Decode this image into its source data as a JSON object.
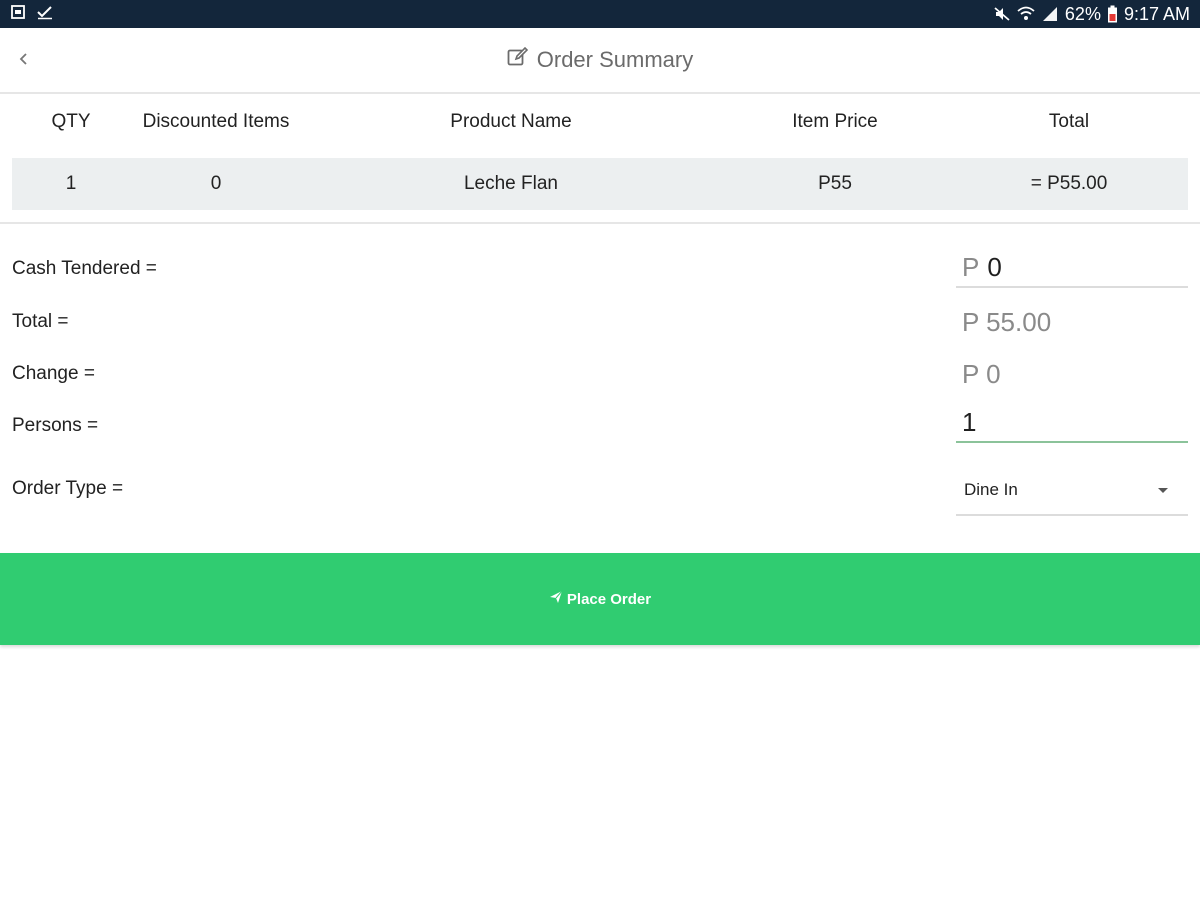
{
  "status_bar": {
    "battery": "62%",
    "time": "9:17 AM"
  },
  "header": {
    "title": "Order Summary"
  },
  "table": {
    "headers": [
      "QTY",
      "Discounted Items",
      "Product Name",
      "Item Price",
      "Total"
    ],
    "rows": [
      {
        "qty": "1",
        "discounted": "0",
        "name": "Leche Flan",
        "price": "P55",
        "total": "= P55.00"
      }
    ]
  },
  "form": {
    "cash_tendered": {
      "label": "Cash Tendered =",
      "currency": "P",
      "value": "0"
    },
    "total": {
      "label": "Total =",
      "value": "P 55.00"
    },
    "change": {
      "label": "Change =",
      "value": "P 0"
    },
    "persons": {
      "label": "Persons =",
      "value": "1"
    },
    "order_type": {
      "label": "Order Type =",
      "selected": "Dine In"
    }
  },
  "place_order": {
    "label": "Place Order"
  },
  "colors": {
    "status_bar": "#13263b",
    "accent_green": "#30cc71",
    "row_bg": "#eceff0"
  },
  "icons": [
    "screenshot-icon",
    "checkmark-icon",
    "mute-icon",
    "wifi-icon",
    "signal-icon",
    "battery-icon",
    "back-chevron-icon",
    "edit-icon",
    "send-icon",
    "dropdown-caret-icon"
  ]
}
